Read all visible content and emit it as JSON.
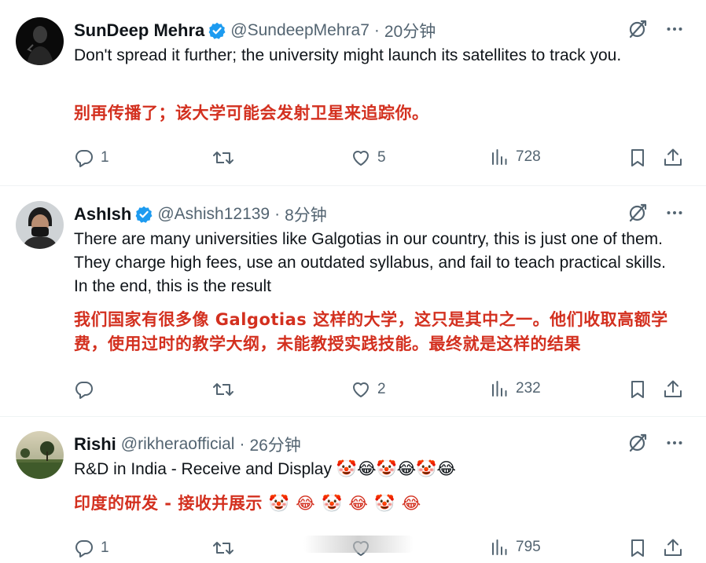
{
  "tweets": [
    {
      "name": "SunDeep Mehra",
      "handle": "@SundeepMehra7",
      "time": "20分钟",
      "text": "Don't spread it further; the university might launch its satellites to track you.",
      "translation": "别再传播了；该大学可能会发射卫星来追踪你。",
      "replies": "1",
      "retweets": "",
      "likes": "5",
      "views": "728"
    },
    {
      "name": "AshIsh",
      "handle": "@Ashish12139",
      "time": "8分钟",
      "text": "There are many universities like Galgotias in our country, this is just one of them. They charge high fees, use an outdated syllabus, and fail to teach practical skills. In the end, this is the result",
      "translation": "我们国家有很多像 Galgotias 这样的大学，这只是其中之一。他们收取高额学费，使用过时的教学大纲，未能教授实践技能。最终就是这样的结果",
      "replies": "",
      "retweets": "",
      "likes": "2",
      "views": "232"
    },
    {
      "name": "Rishi",
      "handle": "@rikheraofficial",
      "time": "26分钟",
      "text": "R&D in India - Receive and Display 🤡😂🤡😂🤡😂",
      "translation": "印度的研发 - 接收并展示 🤡 😂 🤡 😂 🤡 😂",
      "replies": "1",
      "retweets": "",
      "likes": "",
      "views": "795"
    }
  ],
  "separator": "·",
  "icons": {
    "verified": "verified-badge-icon",
    "grok": "grok-icon",
    "more": "more-icon",
    "reply": "reply-icon",
    "retweet": "retweet-icon",
    "like": "like-icon",
    "views": "views-icon",
    "bookmark": "bookmark-icon",
    "share": "share-icon"
  },
  "colors": {
    "verified": "#1d9bf0",
    "translation": "#d3301f",
    "secondary": "#536471"
  }
}
